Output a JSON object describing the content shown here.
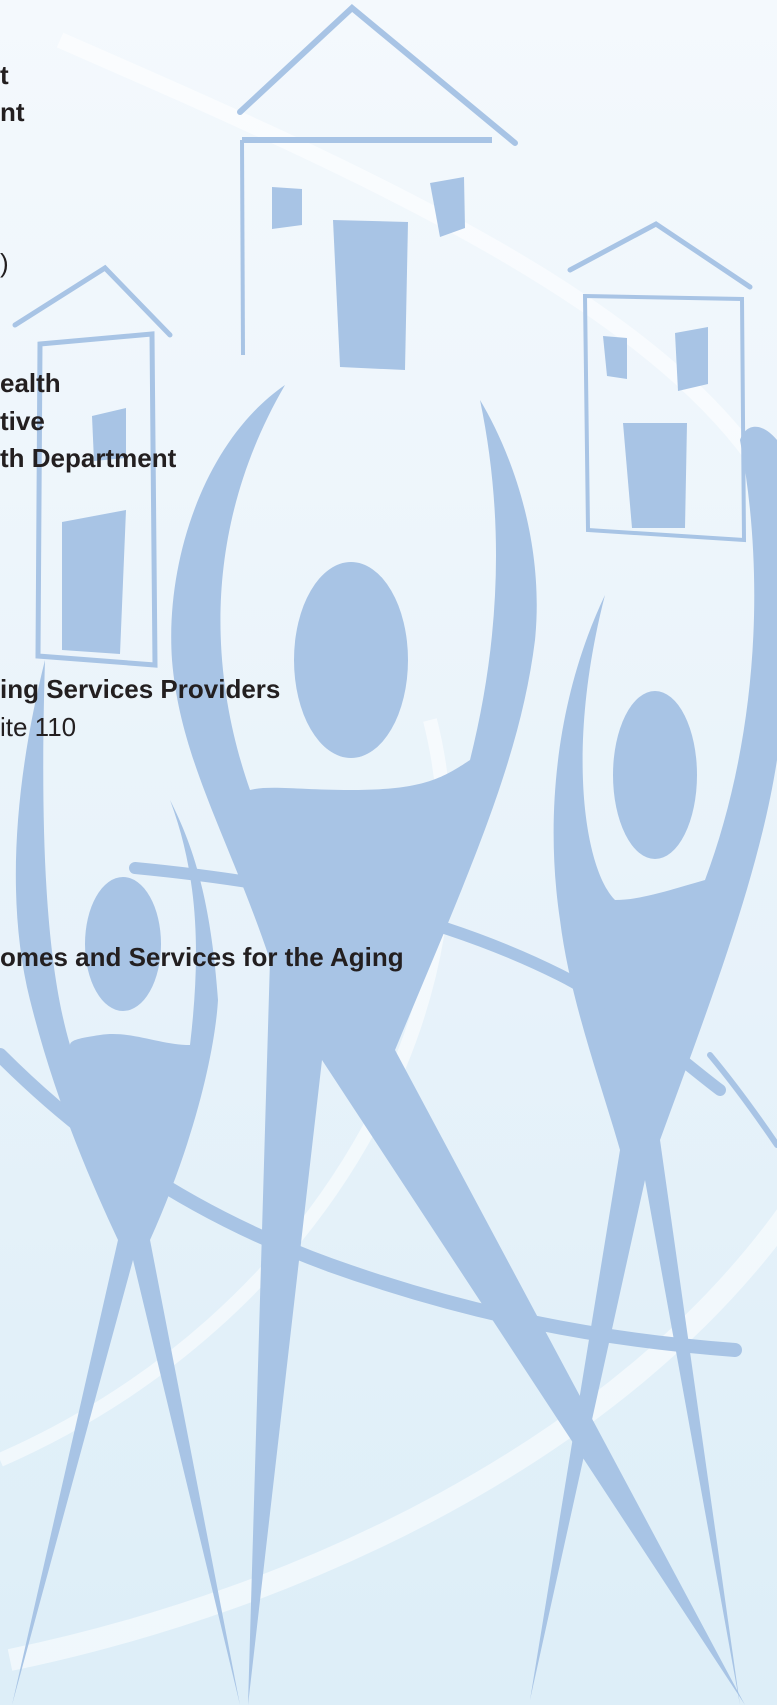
{
  "text_lines": [
    {
      "text": "t",
      "weight": "bold"
    },
    {
      "text": "nt",
      "weight": "bold"
    },
    {
      "text": ")",
      "weight": "normal"
    },
    {
      "text": "ealth",
      "weight": "bold"
    },
    {
      "text": "tive",
      "weight": "bold"
    },
    {
      "text": "th Department",
      "weight": "bold"
    },
    {
      "text": "ing Services Providers",
      "weight": "bold"
    },
    {
      "text": "ite 110",
      "weight": "normal"
    },
    {
      "text": "omes and Services for the Aging",
      "weight": "bold"
    }
  ],
  "colors": {
    "figure": "#a8c4e5",
    "text": "#231f20",
    "swoosh": "#ffffff"
  }
}
